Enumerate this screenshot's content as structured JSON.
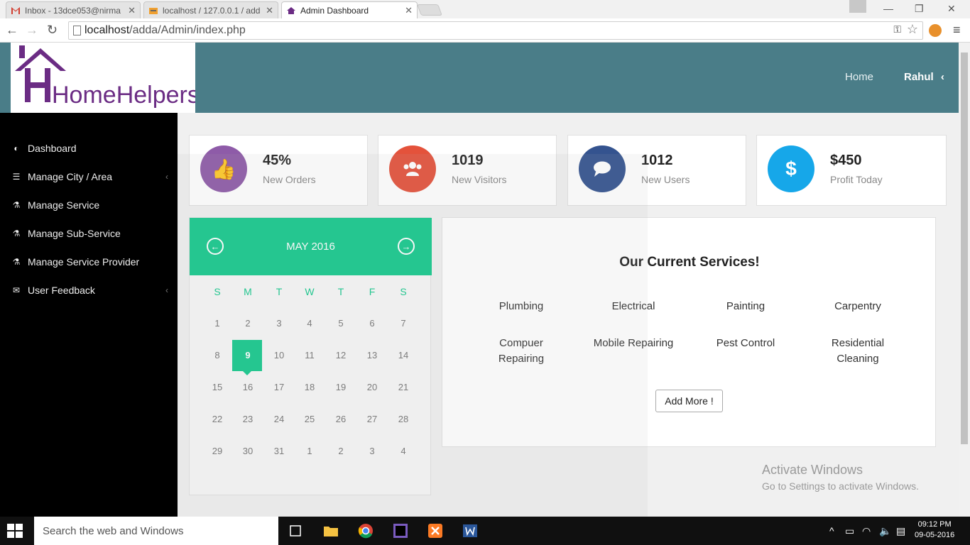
{
  "browser": {
    "tabs": [
      {
        "label": "Inbox - 13dce053@nirma",
        "active": false
      },
      {
        "label": "localhost / 127.0.0.1 / add",
        "active": false
      },
      {
        "label": "Admin Dashboard",
        "active": true
      }
    ],
    "url_host": "localhost",
    "url_path": "/adda/Admin/index.php"
  },
  "topnav": {
    "logo_text": "HomeHelpers",
    "home": "Home",
    "user": "Rahul"
  },
  "sidebar": {
    "items": [
      {
        "label": "Dashboard",
        "icon": "dashboard-icon"
      },
      {
        "label": "Manage City / Area",
        "icon": "list-icon"
      },
      {
        "label": "Manage Service",
        "icon": "flask-icon"
      },
      {
        "label": "Manage Sub-Service",
        "icon": "flask-icon"
      },
      {
        "label": "Manage Service Provider",
        "icon": "flask-icon"
      },
      {
        "label": "User Feedback",
        "icon": "envelope-icon"
      }
    ]
  },
  "stats": [
    {
      "value": "45%",
      "label": "New Orders",
      "color": "#8e5ba8",
      "icon": "thumbs-up-icon"
    },
    {
      "value": "1019",
      "label": "New Visitors",
      "color": "#e4523b",
      "icon": "users-icon"
    },
    {
      "value": "1012",
      "label": "New Users",
      "color": "#34538f",
      "icon": "comment-icon"
    },
    {
      "value": "$450",
      "label": "Profit Today",
      "color": "#16a7e9",
      "icon": "dollar-icon"
    }
  ],
  "calendar": {
    "month": "MAY 2016",
    "weekdays": [
      "S",
      "M",
      "T",
      "W",
      "T",
      "F",
      "S"
    ],
    "weeks": [
      [
        "1",
        "2",
        "3",
        "4",
        "5",
        "6",
        "7"
      ],
      [
        "8",
        "9",
        "10",
        "11",
        "12",
        "13",
        "14"
      ],
      [
        "15",
        "16",
        "17",
        "18",
        "19",
        "20",
        "21"
      ],
      [
        "22",
        "23",
        "24",
        "25",
        "26",
        "27",
        "28"
      ],
      [
        "29",
        "30",
        "31",
        "1",
        "2",
        "3",
        "4"
      ]
    ],
    "today": "9",
    "accent": "#16c98d"
  },
  "services": {
    "title": "Our Current Services!",
    "items": [
      "Plumbing",
      "Electrical",
      "Painting",
      "Carpentry",
      "Compuer Repairing",
      "Mobile Repairing",
      "Pest Control",
      "Residential Cleaning"
    ],
    "add_button": "Add More !"
  },
  "watermark": {
    "line1": "Activate Windows",
    "line2": "Go to Settings to activate Windows."
  },
  "taskbar": {
    "search_placeholder": "Search the web and Windows",
    "time": "09:12 PM",
    "date": "09-05-2016"
  }
}
